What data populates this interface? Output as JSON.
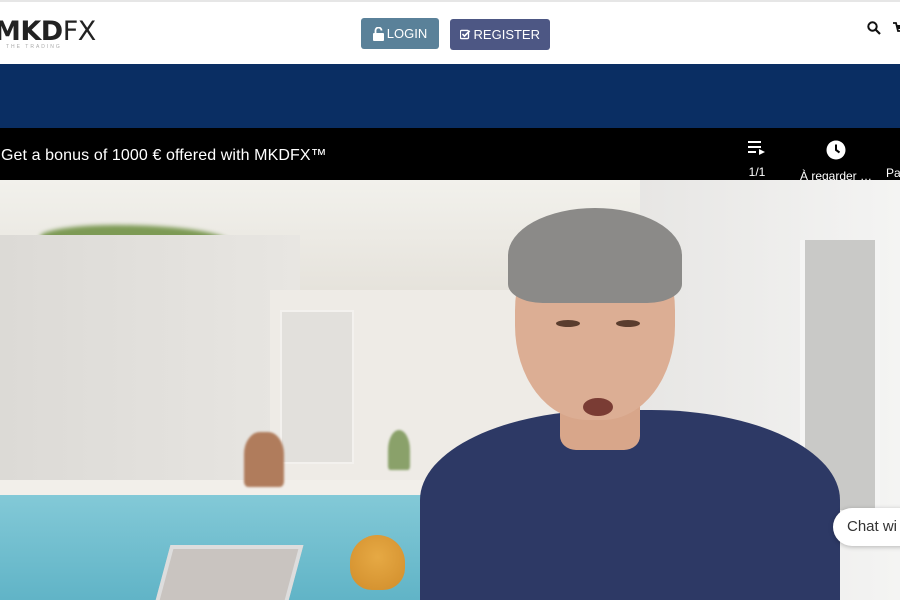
{
  "header": {
    "logo_bold": "MKD",
    "logo_light": "FX",
    "logo_tagline": "THE TRADING",
    "login_label": "LOGIN",
    "register_label": "REGISTER"
  },
  "video": {
    "title": "Get a bonus of 1000 € offered with MKDFX™",
    "playlist_count": "1/1",
    "watch_later_label": "À regarder …",
    "share_label": "Pa"
  },
  "chat": {
    "label": "Chat wi"
  },
  "colors": {
    "login_button": "#5a8199",
    "register_button": "#4d5784",
    "blue_band": "#0a2e63",
    "video_bar": "#000000"
  },
  "icons": [
    "lock-open-icon",
    "check-square-icon",
    "search-icon",
    "cart-icon",
    "playlist-icon",
    "clock-icon"
  ]
}
